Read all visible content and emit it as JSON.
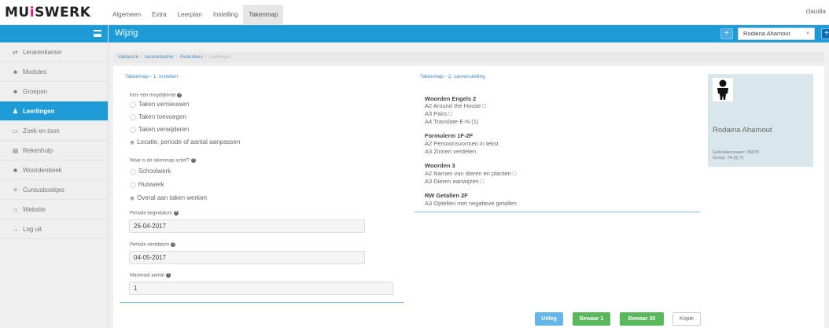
{
  "app": {
    "logo_main": "MU",
    "logo_accent": "i",
    "logo_rest": "SWERK",
    "user": "claudia"
  },
  "top_tabs": [
    "Algemeen",
    "Extra",
    "Leerplan",
    "Instelling",
    "Takenmap"
  ],
  "header": {
    "title": "Wijzig",
    "student_select": "Rodaina Ahamout"
  },
  "sidebar": {
    "items": [
      {
        "label": "Lerarenkamer",
        "icon": "⇄"
      },
      {
        "label": "Modules",
        "icon": "♣"
      },
      {
        "label": "Groepen",
        "icon": "♣"
      },
      {
        "label": "Leerlingen",
        "icon": "♟"
      },
      {
        "label": "Zoek en toon",
        "icon": "▭"
      },
      {
        "label": "Rekenhulp",
        "icon": "▤"
      },
      {
        "label": "Woordenboek",
        "icon": "■"
      },
      {
        "label": "Cursusboekjes",
        "icon": "≡"
      },
      {
        "label": "Website",
        "icon": "⌂"
      },
      {
        "label": "Log uit",
        "icon": "→"
      }
    ]
  },
  "breadcrumb": [
    "Vakkeuze",
    "Lerarenkamer",
    "Gebruikers",
    "Leerlingen"
  ],
  "left_section": {
    "heading": "Takenmap - 1: Instellen",
    "choice_label": "Kies een mogelijkheid",
    "choices": [
      "Taken vernieuwen",
      "Taken toevoegen",
      "Taken verwijderen",
      "Locatie, periode of aantal aanpassen"
    ],
    "active_label": "Waar is de takenmap actief?",
    "active_options": [
      "Schoolwerk",
      "Huiswerk",
      "Overal aan taken werken"
    ],
    "start_label": "Periode begindatum",
    "start_value": "26-04-2017",
    "end_label": "Periode einddatum",
    "end_value": "04-05-2017",
    "max_label": "Maximaal aantal",
    "max_value": "1"
  },
  "mid_section": {
    "heading": "Takenmap - 2: samenstelling",
    "groups": [
      {
        "title": "Woorden Engels 2",
        "items": [
          "A2 Around the House □",
          "A3 Pairs □",
          "A4 Translate E-N (1)"
        ]
      },
      {
        "title": "Formulerm 1F-2F",
        "items": [
          "A2 Persoonsvormen in tekst",
          "A3 Zinnen verdelen"
        ]
      },
      {
        "title": "Woorden 3",
        "items": [
          "A2 Namen van dieren en planten □",
          "A3 Dieren aanwijzen □"
        ]
      },
      {
        "title": "RW Getallen 2F",
        "items": [
          "A3 Optellen met negatieve getallen"
        ]
      }
    ]
  },
  "profile": {
    "name": "Rodaina Ahamout",
    "username": "Gebruikersnaam: 96875",
    "group": "Groep: 7A (§) 7)"
  },
  "buttons": {
    "uitleg": "Uitleg",
    "bewaar1": "Bewaar 1",
    "bewaar30": "Bewaar 30",
    "kopie": "Kopie"
  },
  "colors": {
    "primary": "#1d9bd7",
    "accent": "#e8177f",
    "green": "#58b85b"
  }
}
